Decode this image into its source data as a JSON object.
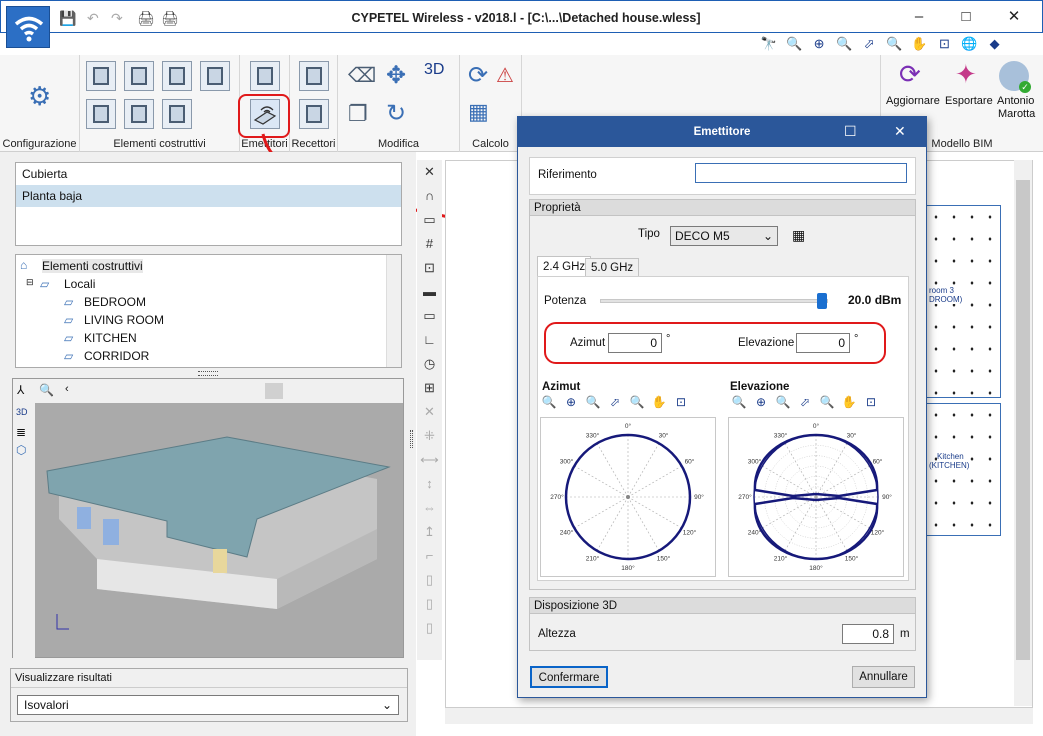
{
  "window": {
    "title": "CYPETEL Wireless - v2018.l - [C:\\...\\Detached house.wless]",
    "controls": [
      "–",
      "□",
      "✕"
    ],
    "quick_access": [
      "💾",
      "↶",
      "↷",
      "🖨",
      "🖨"
    ]
  },
  "toolbar2": [
    "🔭",
    "🔍",
    "⊕",
    "🔍",
    "⬀",
    "🔍",
    "✋",
    "⊡",
    "🌐",
    "◆"
  ],
  "ribbon": {
    "groups": [
      {
        "label": "Configurazione"
      },
      {
        "label": "Elementi costruttivi"
      },
      {
        "label": "Emettitori"
      },
      {
        "label": "Recettori"
      },
      {
        "label": "Modifica"
      },
      {
        "label": "Calcolo"
      },
      {
        "label": "Modello BIM"
      }
    ],
    "bim_buttons": [
      "Aggiornare",
      "Esportare"
    ],
    "user": {
      "first": "Antonio",
      "last": "Marotta"
    }
  },
  "floors": [
    "Cubierta",
    "Planta baja"
  ],
  "tree": {
    "root": "Elementi costruttivi",
    "locals": "Locali",
    "rooms": [
      "BEDROOM",
      "LIVING ROOM",
      "KITCHEN",
      "CORRIDOR"
    ]
  },
  "results": {
    "label": "Visualizzare risultati",
    "selected": "Isovalori"
  },
  "canvas_rooms": {
    "room3_line1": "room 3",
    "room3_line2": "DROOM)",
    "kitchen_line1": "Kitchen",
    "kitchen_line2": "(KITCHEN)"
  },
  "dialog": {
    "title": "Emettitore",
    "riferimento_label": "Riferimento",
    "riferimento_value": "",
    "proprieta": "Proprietà",
    "tipo_label": "Tipo",
    "tipo_value": "DECO M5",
    "tabs": [
      "2.4 GHz",
      "5.0 GHz"
    ],
    "potenza_label": "Potenza",
    "potenza_value": "20.0 dBm",
    "potenza_fraction": 0.98,
    "azimut_label": "Azimut",
    "azimut_value": "0",
    "elevazione_label": "Elevazione",
    "elevazione_value": "0",
    "deg": "°",
    "polar_azimut_title": "Azimut",
    "polar_elev_title": "Elevazione",
    "polar_labels": [
      "0°",
      "30°",
      "60°",
      "90°",
      "120°",
      "150°",
      "180°",
      "210°",
      "240°",
      "270°",
      "300°",
      "330°"
    ],
    "disposizione": "Disposizione 3D",
    "altezza_label": "Altezza",
    "altezza_value": "0.8",
    "altezza_unit": "m",
    "confirm": "Confermare",
    "cancel": "Annullare"
  },
  "colors": {
    "accent": "#2b579a",
    "annotation": "#e0191a",
    "polar": "#16197a"
  }
}
